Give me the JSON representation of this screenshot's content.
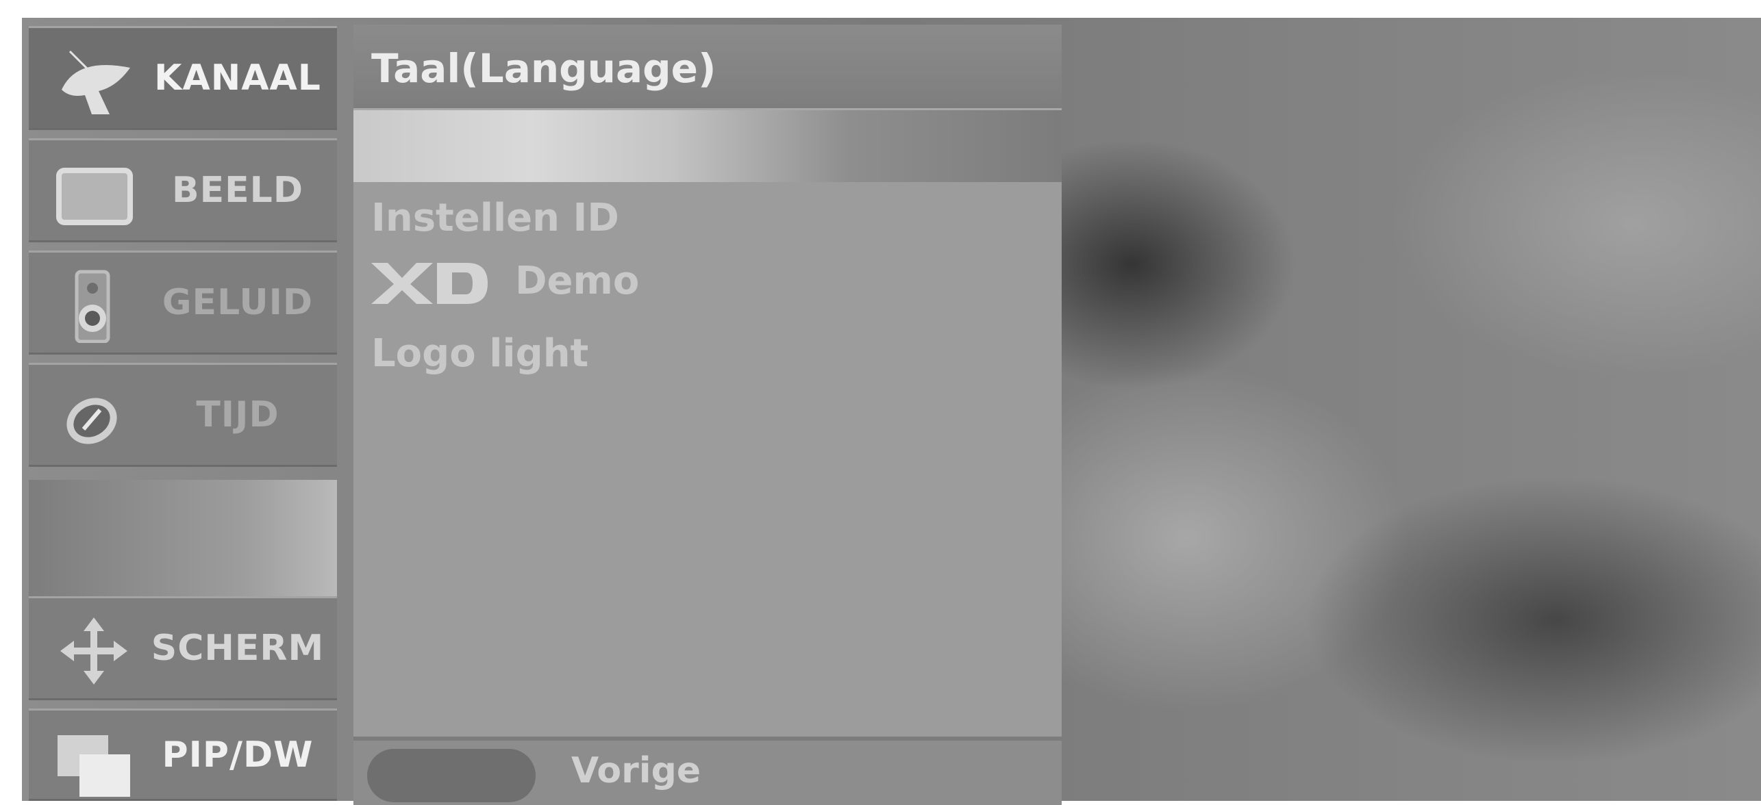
{
  "menu": {
    "items": [
      {
        "label": "KANAAL",
        "icon": "satellite-icon",
        "color": "#f2f2f2",
        "active": true
      },
      {
        "label": "BEELD",
        "icon": "tv-screen-icon",
        "color": "#d2d2d2",
        "active": false
      },
      {
        "label": "GELUID",
        "icon": "speaker-icon",
        "color": "#a9a9a9",
        "active": false
      },
      {
        "label": "TIJD",
        "icon": "clock-icon",
        "color": "#a9a9a9",
        "active": false
      },
      {
        "label": "SCHERM",
        "icon": "move-arrows-icon",
        "color": "#d6d6d6",
        "active": false
      },
      {
        "label": "PIP/DW",
        "icon": "pip-icon",
        "color": "#f0f0f0",
        "active": false
      }
    ]
  },
  "panel": {
    "title": "Taal(Language)",
    "options": [
      {
        "label": "Instellen ID"
      },
      {
        "label": "Demo",
        "logo": "XD"
      },
      {
        "label": "Logo light"
      }
    ]
  },
  "footer": {
    "button_label": "Vorige",
    "button_color": "#6f6f6f"
  }
}
